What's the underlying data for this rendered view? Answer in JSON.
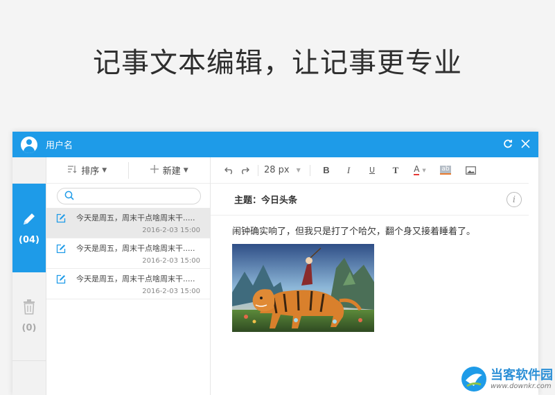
{
  "hero": {
    "title": "记事文本编辑，让记事更专业"
  },
  "window": {
    "username": "用户名",
    "title_actions": {
      "refresh_icon": "refresh-icon",
      "close_icon": "close-icon"
    }
  },
  "sidebar": {
    "notes_count": "(04)",
    "trash_count": "(0)"
  },
  "list": {
    "sort_label": "排序",
    "new_label": "新建",
    "search": {
      "placeholder": "",
      "value": ""
    },
    "items": [
      {
        "snippet": "今天是周五，周末干点啥周末干.....",
        "date": "2016-2-03 15:00"
      },
      {
        "snippet": "今天是周五，周末干点啥周末干.....",
        "date": "2016-2-03 15:00"
      },
      {
        "snippet": "今天是周五，周末干点啥周末干.....",
        "date": "2016-2-03 15:00"
      }
    ]
  },
  "editor": {
    "toolbar": {
      "font_size": "28 px",
      "bold": "B",
      "italic": "I",
      "underline": "U",
      "text_style": "T",
      "font_color": "A",
      "highlight": "ab"
    },
    "subject": "主题：今日头条",
    "body": "闹钟确实响了，但我只是打了个哈欠，翻个身又接着睡着了。"
  },
  "watermark": {
    "name": "当客软件园",
    "url": "www.downkr.com"
  },
  "colors": {
    "accent": "#1e9be8",
    "active_row": "#e9e9e9"
  }
}
